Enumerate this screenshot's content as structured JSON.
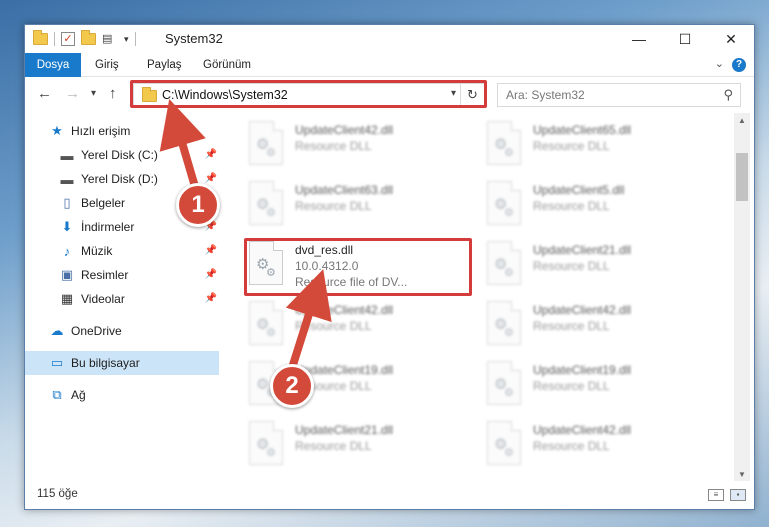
{
  "window": {
    "title": "System32",
    "controls": {
      "minimize": "—",
      "maximize": "☐",
      "close": "✕"
    }
  },
  "ribbon": {
    "tabs": [
      "Dosya",
      "Giriş",
      "Paylaş",
      "Görünüm"
    ],
    "help": "?"
  },
  "address": {
    "path": "C:\\Windows\\System32",
    "refresh": "↻"
  },
  "search": {
    "placeholder": "Ara: System32"
  },
  "sidebar": {
    "items": [
      {
        "label": "Hızlı erişim",
        "icon": "star-icon"
      },
      {
        "label": "Yerel Disk (C:)",
        "icon": "drive-icon",
        "pinned": true
      },
      {
        "label": "Yerel Disk (D:)",
        "icon": "drive-icon",
        "pinned": true
      },
      {
        "label": "Belgeler",
        "icon": "documents-icon",
        "pinned": true
      },
      {
        "label": "İndirmeler",
        "icon": "download-icon",
        "pinned": true
      },
      {
        "label": "Müzik",
        "icon": "music-icon",
        "pinned": true
      },
      {
        "label": "Resimler",
        "icon": "pictures-icon",
        "pinned": true
      },
      {
        "label": "Videolar",
        "icon": "videos-icon",
        "pinned": true
      },
      {
        "label": "OneDrive",
        "icon": "cloud-icon"
      },
      {
        "label": "Bu bilgisayar",
        "icon": "computer-icon",
        "selected": true
      },
      {
        "label": "Ağ",
        "icon": "network-icon"
      }
    ]
  },
  "files": [
    {
      "name": "UpdateClient42.dll",
      "desc": "Resource DLL"
    },
    {
      "name": "UpdateClient65.dll",
      "desc": "Resource DLL"
    },
    {
      "name": "UpdateClient63.dll",
      "desc": "Resource DLL"
    },
    {
      "name": "UpdateClient5.dll",
      "desc": "Resource DLL"
    },
    {
      "name": "dvd_res.dll",
      "desc": "10.0.4312.0",
      "desc2": "Resource file of DV..."
    },
    {
      "name": "UpdateClient21.dll",
      "desc": "Resource DLL"
    },
    {
      "name": "UpdateClient42.dll",
      "desc": "Resource DLL"
    },
    {
      "name": "UpdateClient42.dll",
      "desc": "Resource DLL"
    },
    {
      "name": "UpdateClient19.dll",
      "desc": "Resource DLL"
    },
    {
      "name": "UpdateClient19.dll",
      "desc": "Resource DLL"
    },
    {
      "name": "UpdateClient21.dll",
      "desc": "Resource DLL"
    },
    {
      "name": "UpdateClient42.dll",
      "desc": "Resource DLL"
    }
  ],
  "status": {
    "count": "115 öğe"
  },
  "annotations": {
    "step1": "1",
    "step2": "2",
    "color": "#d44a3a"
  }
}
